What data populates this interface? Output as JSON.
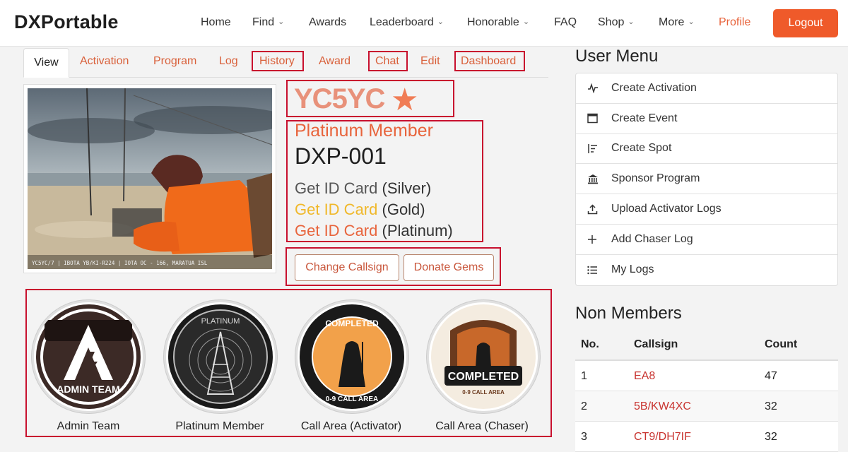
{
  "brand": "DXPortable",
  "nav": {
    "home": "Home",
    "find": "Find",
    "awards": "Awards",
    "leaderboard": "Leaderboard",
    "honorable": "Honorable",
    "faq": "FAQ",
    "shop": "Shop",
    "more": "More",
    "profile": "Profile",
    "logout": "Logout"
  },
  "tabs": [
    "View",
    "Activation",
    "Program",
    "Log",
    "History",
    "Award",
    "Chat",
    "Edit",
    "Dashboard"
  ],
  "photo": {
    "caption": "YC5YC/7 | IBOTA YB/KI-R224 | IOTA OC - 166, MARATUA ISL"
  },
  "profile": {
    "callsign": "YC5YC",
    "star": "★",
    "membership": "Platinum Member",
    "member_id": "DXP-001",
    "id_cards": [
      {
        "link": "Get ID Card",
        "tier": "(Silver)"
      },
      {
        "link": "Get ID Card",
        "tier": "(Gold)"
      },
      {
        "link": "Get ID Card",
        "tier": "(Platinum)"
      }
    ],
    "change_callsign": "Change Callsign",
    "donate_gems": "Donate Gems"
  },
  "badges": [
    {
      "label": "Admin Team",
      "art_text": "ADMIN TEAM"
    },
    {
      "label": "Platinum Member",
      "art_text": "PLATINUM"
    },
    {
      "label": "Call Area (Activator)",
      "art_text": "COMPLETED",
      "art_sub": "0-9 CALL AREA"
    },
    {
      "label": "Call Area (Chaser)",
      "art_text": "COMPLETED",
      "art_sub": "0-9 CALL AREA"
    }
  ],
  "user_menu": {
    "title": "User Menu",
    "items": [
      {
        "label": "Create Activation",
        "icon": "activity-icon"
      },
      {
        "label": "Create Event",
        "icon": "calendar-icon"
      },
      {
        "label": "Create Spot",
        "icon": "list-filter-icon"
      },
      {
        "label": "Sponsor Program",
        "icon": "bank-icon"
      },
      {
        "label": "Upload Activator Logs",
        "icon": "upload-icon"
      },
      {
        "label": "Add Chaser Log",
        "icon": "plus-icon"
      },
      {
        "label": "My Logs",
        "icon": "list-icon"
      }
    ]
  },
  "non_members": {
    "title": "Non Members",
    "headers": [
      "No.",
      "Callsign",
      "Count"
    ],
    "rows": [
      {
        "no": "1",
        "callsign": "EA8",
        "count": "47"
      },
      {
        "no": "2",
        "callsign": "5B/KW4XC",
        "count": "32"
      },
      {
        "no": "3",
        "callsign": "CT9/DH7IF",
        "count": "32"
      }
    ]
  },
  "colors": {
    "accent": "#ef5a2a",
    "link": "#d9603a",
    "highlight_box": "#c8102e",
    "gold": "#f0b82a"
  }
}
